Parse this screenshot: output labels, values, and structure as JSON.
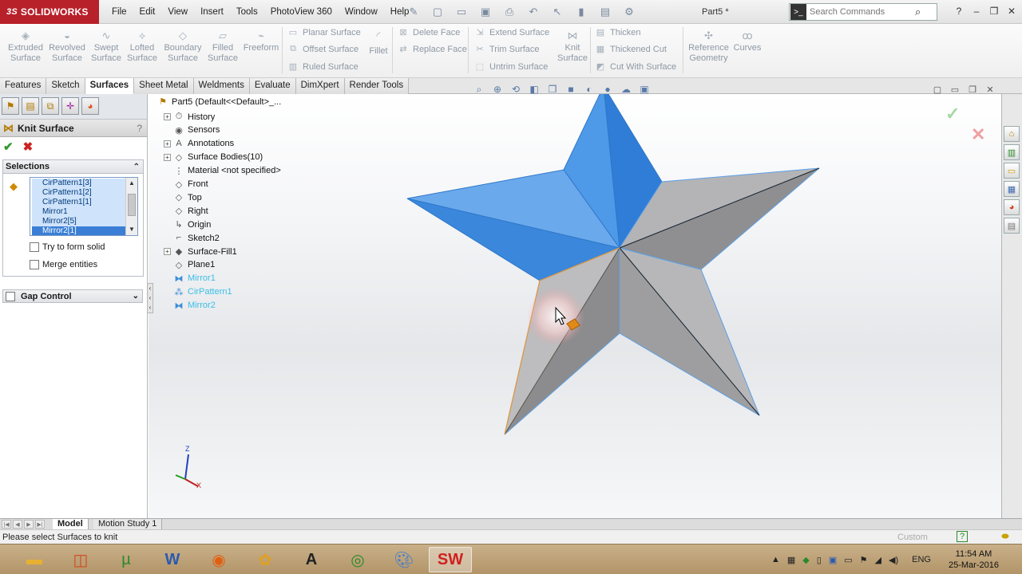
{
  "app": {
    "logo_text": "SOLIDWORKS",
    "logo_prefix": "3S",
    "document_title": "Part5 *",
    "search_placeholder": "Search Commands"
  },
  "menu": [
    "File",
    "Edit",
    "View",
    "Insert",
    "Tools",
    "PhotoView 360",
    "Window",
    "Help"
  ],
  "ribbon": {
    "large_buttons": [
      {
        "label": "Extruded\nSurface",
        "icon": "extruded-surface-icon"
      },
      {
        "label": "Revolved\nSurface",
        "icon": "revolved-surface-icon"
      },
      {
        "label": "Swept\nSurface",
        "icon": "swept-surface-icon"
      },
      {
        "label": "Lofted\nSurface",
        "icon": "lofted-surface-icon"
      },
      {
        "label": "Boundary\nSurface",
        "icon": "boundary-surface-icon"
      },
      {
        "label": "Filled\nSurface",
        "icon": "filled-surface-icon"
      },
      {
        "label": "Freeform",
        "icon": "freeform-icon"
      }
    ],
    "small_buttons_1": [
      "Planar Surface",
      "Offset Surface",
      "Ruled Surface"
    ],
    "fillet": "Fillet",
    "small_buttons_2": [
      "Delete Face",
      "Replace Face"
    ],
    "small_buttons_3": [
      "Extend Surface",
      "Trim Surface",
      "Untrim Surface"
    ],
    "knit": "Knit\nSurface",
    "small_buttons_4": [
      "Thicken",
      "Thickened Cut",
      "Cut With Surface"
    ],
    "reference_geometry": "Reference\nGeometry",
    "curves": "Curves"
  },
  "tabs": [
    "Features",
    "Sketch",
    "Surfaces",
    "Sheet Metal",
    "Weldments",
    "Evaluate",
    "DimXpert",
    "Render Tools"
  ],
  "active_tab": "Surfaces",
  "property_manager": {
    "title": "Knit Surface",
    "help": "?",
    "selections_label": "Selections",
    "selection_items": [
      "CirPattern1[3]",
      "CirPattern1[2]",
      "CirPattern1[1]",
      "Mirror1",
      "Mirror2[5]",
      "Mirror2[1]"
    ],
    "try_to_form_solid": "Try to form solid",
    "merge_entities": "Merge entities",
    "gap_control": "Gap Control"
  },
  "feature_tree": {
    "root": "Part5  (Default<<Default>_...",
    "nodes": [
      {
        "label": "History",
        "expandable": true,
        "hidden": false
      },
      {
        "label": "Sensors",
        "expandable": false,
        "hidden": false
      },
      {
        "label": "Annotations",
        "expandable": true,
        "hidden": false
      },
      {
        "label": "Surface Bodies(10)",
        "expandable": true,
        "hidden": false
      },
      {
        "label": "Material <not specified>",
        "expandable": false,
        "hidden": false
      },
      {
        "label": "Front",
        "expandable": false,
        "hidden": false
      },
      {
        "label": "Top",
        "expandable": false,
        "hidden": false
      },
      {
        "label": "Right",
        "expandable": false,
        "hidden": false
      },
      {
        "label": "Origin",
        "expandable": false,
        "hidden": false
      },
      {
        "label": "Sketch2",
        "expandable": false,
        "hidden": false
      },
      {
        "label": "Surface-Fill1",
        "expandable": true,
        "hidden": false
      },
      {
        "label": "Plane1",
        "expandable": false,
        "hidden": false
      },
      {
        "label": "Mirror1",
        "expandable": false,
        "hidden": true
      },
      {
        "label": "CirPattern1",
        "expandable": false,
        "hidden": true
      },
      {
        "label": "Mirror2",
        "expandable": false,
        "hidden": true
      }
    ]
  },
  "triad": {
    "z": "Z",
    "x": "X"
  },
  "model_tabs": [
    "Model",
    "Motion Study 1"
  ],
  "status": {
    "message": "Please select Surfaces to knit",
    "units": "Custom"
  },
  "taskbar": {
    "language": "ENG",
    "time": "11:54 AM",
    "date": "25-Mar-2016"
  },
  "colors": {
    "brand_red": "#b8202a",
    "selected_face_blue": "#3d8ee6",
    "star_gray": "#a9a9ab",
    "hidden_feature_cyan": "#3bbee6"
  }
}
